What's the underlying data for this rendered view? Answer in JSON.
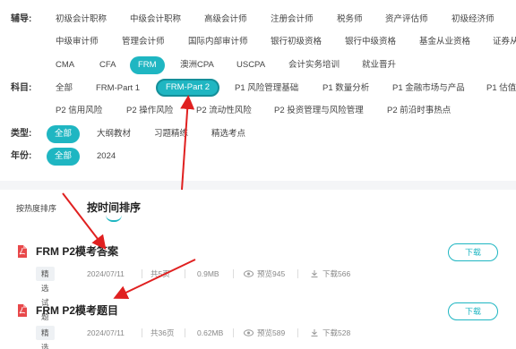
{
  "filters": {
    "rows": [
      {
        "label": "辅导:",
        "items": [
          [
            "初级会计职称",
            "中级会计职称",
            "高级会计师",
            "注册会计师",
            "税务师",
            "资产评估师",
            "初级经济师"
          ],
          [
            "中级审计师",
            "管理会计师",
            "国际内部审计师",
            "银行初级资格",
            "银行中级资格",
            "基金从业资格",
            "证券从业"
          ],
          [
            "CMA",
            "CFA",
            "FRM",
            "澳洲CPA",
            "USCPA",
            "会计实务培训",
            "就业晋升"
          ]
        ],
        "active": "FRM"
      },
      {
        "label": "科目:",
        "items": [
          [
            "全部",
            "FRM-Part 1",
            "FRM-Part 2",
            "P1 风险管理基础",
            "P1 数量分析",
            "P1 金融市场与产品",
            "P1 估值"
          ],
          [
            "P2 信用风险",
            "P2 操作风险",
            "P2 流动性风险",
            "P2 投资管理与风险管理",
            "P2 前沿时事热点"
          ]
        ],
        "active": "FRM-Part 2"
      },
      {
        "label": "类型:",
        "items": [
          [
            "全部",
            "大纲教材",
            "习题精练",
            "精选考点"
          ]
        ],
        "active": "全部"
      },
      {
        "label": "年份:",
        "items": [
          [
            "全部",
            "2024"
          ]
        ],
        "active": "全部"
      }
    ]
  },
  "sort": {
    "heat": "按热度排序",
    "time": "按时间排序"
  },
  "items": [
    {
      "title": "FRM P2模考答案",
      "tag": "精选试题",
      "date": "2024/07/11",
      "pages": "共5页",
      "size": "0.9MB",
      "views": "预览945",
      "downloads": "下载566",
      "button": "下载"
    },
    {
      "title": "FRM P2模考题目",
      "tag": "精选试题",
      "date": "2024/07/11",
      "pages": "共36页",
      "size": "0.62MB",
      "views": "预览589",
      "downloads": "下载528",
      "button": "下载"
    }
  ],
  "colors": {
    "accent": "#1fb6c2",
    "arrow": "#e02020",
    "pdf": "#e8484a"
  }
}
